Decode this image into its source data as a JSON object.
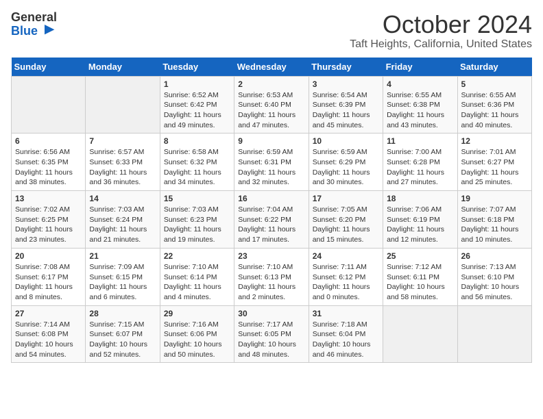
{
  "logo": {
    "general": "General",
    "blue": "Blue"
  },
  "title": "October 2024",
  "location": "Taft Heights, California, United States",
  "weekdays": [
    "Sunday",
    "Monday",
    "Tuesday",
    "Wednesday",
    "Thursday",
    "Friday",
    "Saturday"
  ],
  "weeks": [
    [
      {
        "day": "",
        "sunrise": "",
        "sunset": "",
        "daylight": ""
      },
      {
        "day": "",
        "sunrise": "",
        "sunset": "",
        "daylight": ""
      },
      {
        "day": "1",
        "sunrise": "Sunrise: 6:52 AM",
        "sunset": "Sunset: 6:42 PM",
        "daylight": "Daylight: 11 hours and 49 minutes."
      },
      {
        "day": "2",
        "sunrise": "Sunrise: 6:53 AM",
        "sunset": "Sunset: 6:40 PM",
        "daylight": "Daylight: 11 hours and 47 minutes."
      },
      {
        "day": "3",
        "sunrise": "Sunrise: 6:54 AM",
        "sunset": "Sunset: 6:39 PM",
        "daylight": "Daylight: 11 hours and 45 minutes."
      },
      {
        "day": "4",
        "sunrise": "Sunrise: 6:55 AM",
        "sunset": "Sunset: 6:38 PM",
        "daylight": "Daylight: 11 hours and 43 minutes."
      },
      {
        "day": "5",
        "sunrise": "Sunrise: 6:55 AM",
        "sunset": "Sunset: 6:36 PM",
        "daylight": "Daylight: 11 hours and 40 minutes."
      }
    ],
    [
      {
        "day": "6",
        "sunrise": "Sunrise: 6:56 AM",
        "sunset": "Sunset: 6:35 PM",
        "daylight": "Daylight: 11 hours and 38 minutes."
      },
      {
        "day": "7",
        "sunrise": "Sunrise: 6:57 AM",
        "sunset": "Sunset: 6:33 PM",
        "daylight": "Daylight: 11 hours and 36 minutes."
      },
      {
        "day": "8",
        "sunrise": "Sunrise: 6:58 AM",
        "sunset": "Sunset: 6:32 PM",
        "daylight": "Daylight: 11 hours and 34 minutes."
      },
      {
        "day": "9",
        "sunrise": "Sunrise: 6:59 AM",
        "sunset": "Sunset: 6:31 PM",
        "daylight": "Daylight: 11 hours and 32 minutes."
      },
      {
        "day": "10",
        "sunrise": "Sunrise: 6:59 AM",
        "sunset": "Sunset: 6:29 PM",
        "daylight": "Daylight: 11 hours and 30 minutes."
      },
      {
        "day": "11",
        "sunrise": "Sunrise: 7:00 AM",
        "sunset": "Sunset: 6:28 PM",
        "daylight": "Daylight: 11 hours and 27 minutes."
      },
      {
        "day": "12",
        "sunrise": "Sunrise: 7:01 AM",
        "sunset": "Sunset: 6:27 PM",
        "daylight": "Daylight: 11 hours and 25 minutes."
      }
    ],
    [
      {
        "day": "13",
        "sunrise": "Sunrise: 7:02 AM",
        "sunset": "Sunset: 6:25 PM",
        "daylight": "Daylight: 11 hours and 23 minutes."
      },
      {
        "day": "14",
        "sunrise": "Sunrise: 7:03 AM",
        "sunset": "Sunset: 6:24 PM",
        "daylight": "Daylight: 11 hours and 21 minutes."
      },
      {
        "day": "15",
        "sunrise": "Sunrise: 7:03 AM",
        "sunset": "Sunset: 6:23 PM",
        "daylight": "Daylight: 11 hours and 19 minutes."
      },
      {
        "day": "16",
        "sunrise": "Sunrise: 7:04 AM",
        "sunset": "Sunset: 6:22 PM",
        "daylight": "Daylight: 11 hours and 17 minutes."
      },
      {
        "day": "17",
        "sunrise": "Sunrise: 7:05 AM",
        "sunset": "Sunset: 6:20 PM",
        "daylight": "Daylight: 11 hours and 15 minutes."
      },
      {
        "day": "18",
        "sunrise": "Sunrise: 7:06 AM",
        "sunset": "Sunset: 6:19 PM",
        "daylight": "Daylight: 11 hours and 12 minutes."
      },
      {
        "day": "19",
        "sunrise": "Sunrise: 7:07 AM",
        "sunset": "Sunset: 6:18 PM",
        "daylight": "Daylight: 11 hours and 10 minutes."
      }
    ],
    [
      {
        "day": "20",
        "sunrise": "Sunrise: 7:08 AM",
        "sunset": "Sunset: 6:17 PM",
        "daylight": "Daylight: 11 hours and 8 minutes."
      },
      {
        "day": "21",
        "sunrise": "Sunrise: 7:09 AM",
        "sunset": "Sunset: 6:15 PM",
        "daylight": "Daylight: 11 hours and 6 minutes."
      },
      {
        "day": "22",
        "sunrise": "Sunrise: 7:10 AM",
        "sunset": "Sunset: 6:14 PM",
        "daylight": "Daylight: 11 hours and 4 minutes."
      },
      {
        "day": "23",
        "sunrise": "Sunrise: 7:10 AM",
        "sunset": "Sunset: 6:13 PM",
        "daylight": "Daylight: 11 hours and 2 minutes."
      },
      {
        "day": "24",
        "sunrise": "Sunrise: 7:11 AM",
        "sunset": "Sunset: 6:12 PM",
        "daylight": "Daylight: 11 hours and 0 minutes."
      },
      {
        "day": "25",
        "sunrise": "Sunrise: 7:12 AM",
        "sunset": "Sunset: 6:11 PM",
        "daylight": "Daylight: 10 hours and 58 minutes."
      },
      {
        "day": "26",
        "sunrise": "Sunrise: 7:13 AM",
        "sunset": "Sunset: 6:10 PM",
        "daylight": "Daylight: 10 hours and 56 minutes."
      }
    ],
    [
      {
        "day": "27",
        "sunrise": "Sunrise: 7:14 AM",
        "sunset": "Sunset: 6:08 PM",
        "daylight": "Daylight: 10 hours and 54 minutes."
      },
      {
        "day": "28",
        "sunrise": "Sunrise: 7:15 AM",
        "sunset": "Sunset: 6:07 PM",
        "daylight": "Daylight: 10 hours and 52 minutes."
      },
      {
        "day": "29",
        "sunrise": "Sunrise: 7:16 AM",
        "sunset": "Sunset: 6:06 PM",
        "daylight": "Daylight: 10 hours and 50 minutes."
      },
      {
        "day": "30",
        "sunrise": "Sunrise: 7:17 AM",
        "sunset": "Sunset: 6:05 PM",
        "daylight": "Daylight: 10 hours and 48 minutes."
      },
      {
        "day": "31",
        "sunrise": "Sunrise: 7:18 AM",
        "sunset": "Sunset: 6:04 PM",
        "daylight": "Daylight: 10 hours and 46 minutes."
      },
      {
        "day": "",
        "sunrise": "",
        "sunset": "",
        "daylight": ""
      },
      {
        "day": "",
        "sunrise": "",
        "sunset": "",
        "daylight": ""
      }
    ]
  ]
}
